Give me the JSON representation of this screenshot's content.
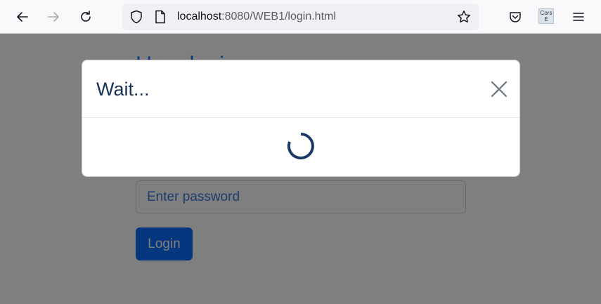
{
  "browser": {
    "url_host": "localhost",
    "url_path": ":8080/WEB1/login.html",
    "extension_label_line1": "Cors",
    "extension_label_line2": "E"
  },
  "page": {
    "heading": "User login",
    "password_placeholder": "Enter password",
    "login_label": "Login"
  },
  "modal": {
    "title": "Wait..."
  },
  "colors": {
    "primary": "#0d6efd",
    "modal_title": "#18325a",
    "spinner": "#1b3a68"
  }
}
